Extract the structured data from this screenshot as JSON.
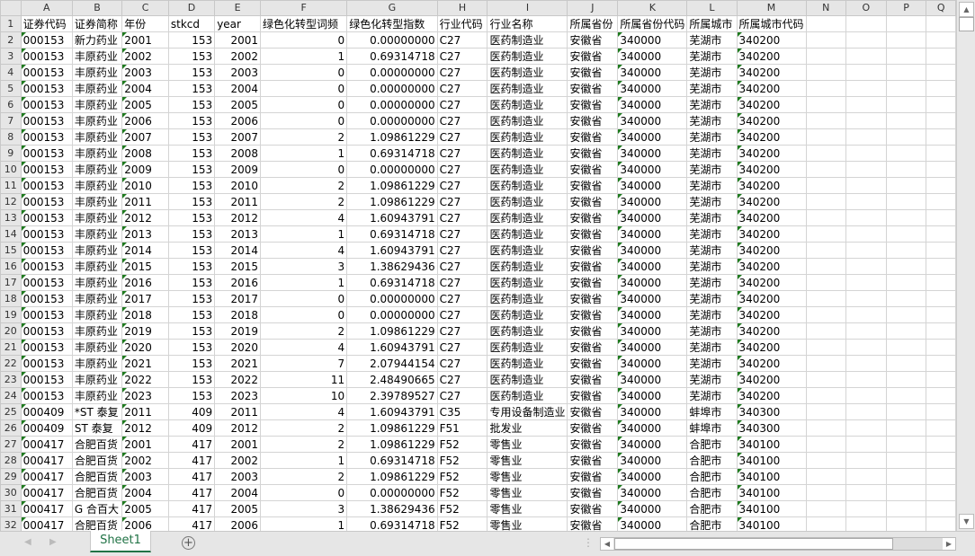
{
  "columns": [
    "A",
    "B",
    "C",
    "D",
    "E",
    "F",
    "G",
    "H",
    "I",
    "J",
    "K",
    "L",
    "M",
    "N",
    "O",
    "P",
    "Q"
  ],
  "headers": [
    "证券代码",
    "证券简称",
    "年份",
    "stkcd",
    "year",
    "绿色化转型词频",
    "绿色化转型指数",
    "行业代码",
    "行业名称",
    "所属省份",
    "所属省份代码",
    "所属城市",
    "所属城市代码"
  ],
  "rows": [
    [
      "000153",
      "新力药业",
      "2001",
      "153",
      "2001",
      "0",
      "0.00000000",
      "C27",
      "医药制造业",
      "安徽省",
      "340000",
      "芜湖市",
      "340200"
    ],
    [
      "000153",
      "丰原药业",
      "2002",
      "153",
      "2002",
      "1",
      "0.69314718",
      "C27",
      "医药制造业",
      "安徽省",
      "340000",
      "芜湖市",
      "340200"
    ],
    [
      "000153",
      "丰原药业",
      "2003",
      "153",
      "2003",
      "0",
      "0.00000000",
      "C27",
      "医药制造业",
      "安徽省",
      "340000",
      "芜湖市",
      "340200"
    ],
    [
      "000153",
      "丰原药业",
      "2004",
      "153",
      "2004",
      "0",
      "0.00000000",
      "C27",
      "医药制造业",
      "安徽省",
      "340000",
      "芜湖市",
      "340200"
    ],
    [
      "000153",
      "丰原药业",
      "2005",
      "153",
      "2005",
      "0",
      "0.00000000",
      "C27",
      "医药制造业",
      "安徽省",
      "340000",
      "芜湖市",
      "340200"
    ],
    [
      "000153",
      "丰原药业",
      "2006",
      "153",
      "2006",
      "0",
      "0.00000000",
      "C27",
      "医药制造业",
      "安徽省",
      "340000",
      "芜湖市",
      "340200"
    ],
    [
      "000153",
      "丰原药业",
      "2007",
      "153",
      "2007",
      "2",
      "1.09861229",
      "C27",
      "医药制造业",
      "安徽省",
      "340000",
      "芜湖市",
      "340200"
    ],
    [
      "000153",
      "丰原药业",
      "2008",
      "153",
      "2008",
      "1",
      "0.69314718",
      "C27",
      "医药制造业",
      "安徽省",
      "340000",
      "芜湖市",
      "340200"
    ],
    [
      "000153",
      "丰原药业",
      "2009",
      "153",
      "2009",
      "0",
      "0.00000000",
      "C27",
      "医药制造业",
      "安徽省",
      "340000",
      "芜湖市",
      "340200"
    ],
    [
      "000153",
      "丰原药业",
      "2010",
      "153",
      "2010",
      "2",
      "1.09861229",
      "C27",
      "医药制造业",
      "安徽省",
      "340000",
      "芜湖市",
      "340200"
    ],
    [
      "000153",
      "丰原药业",
      "2011",
      "153",
      "2011",
      "2",
      "1.09861229",
      "C27",
      "医药制造业",
      "安徽省",
      "340000",
      "芜湖市",
      "340200"
    ],
    [
      "000153",
      "丰原药业",
      "2012",
      "153",
      "2012",
      "4",
      "1.60943791",
      "C27",
      "医药制造业",
      "安徽省",
      "340000",
      "芜湖市",
      "340200"
    ],
    [
      "000153",
      "丰原药业",
      "2013",
      "153",
      "2013",
      "1",
      "0.69314718",
      "C27",
      "医药制造业",
      "安徽省",
      "340000",
      "芜湖市",
      "340200"
    ],
    [
      "000153",
      "丰原药业",
      "2014",
      "153",
      "2014",
      "4",
      "1.60943791",
      "C27",
      "医药制造业",
      "安徽省",
      "340000",
      "芜湖市",
      "340200"
    ],
    [
      "000153",
      "丰原药业",
      "2015",
      "153",
      "2015",
      "3",
      "1.38629436",
      "C27",
      "医药制造业",
      "安徽省",
      "340000",
      "芜湖市",
      "340200"
    ],
    [
      "000153",
      "丰原药业",
      "2016",
      "153",
      "2016",
      "1",
      "0.69314718",
      "C27",
      "医药制造业",
      "安徽省",
      "340000",
      "芜湖市",
      "340200"
    ],
    [
      "000153",
      "丰原药业",
      "2017",
      "153",
      "2017",
      "0",
      "0.00000000",
      "C27",
      "医药制造业",
      "安徽省",
      "340000",
      "芜湖市",
      "340200"
    ],
    [
      "000153",
      "丰原药业",
      "2018",
      "153",
      "2018",
      "0",
      "0.00000000",
      "C27",
      "医药制造业",
      "安徽省",
      "340000",
      "芜湖市",
      "340200"
    ],
    [
      "000153",
      "丰原药业",
      "2019",
      "153",
      "2019",
      "2",
      "1.09861229",
      "C27",
      "医药制造业",
      "安徽省",
      "340000",
      "芜湖市",
      "340200"
    ],
    [
      "000153",
      "丰原药业",
      "2020",
      "153",
      "2020",
      "4",
      "1.60943791",
      "C27",
      "医药制造业",
      "安徽省",
      "340000",
      "芜湖市",
      "340200"
    ],
    [
      "000153",
      "丰原药业",
      "2021",
      "153",
      "2021",
      "7",
      "2.07944154",
      "C27",
      "医药制造业",
      "安徽省",
      "340000",
      "芜湖市",
      "340200"
    ],
    [
      "000153",
      "丰原药业",
      "2022",
      "153",
      "2022",
      "11",
      "2.48490665",
      "C27",
      "医药制造业",
      "安徽省",
      "340000",
      "芜湖市",
      "340200"
    ],
    [
      "000153",
      "丰原药业",
      "2023",
      "153",
      "2023",
      "10",
      "2.39789527",
      "C27",
      "医药制造业",
      "安徽省",
      "340000",
      "芜湖市",
      "340200"
    ],
    [
      "000409",
      "*ST 泰复",
      "2011",
      "409",
      "2011",
      "4",
      "1.60943791",
      "C35",
      "专用设备制造业",
      "安徽省",
      "340000",
      "蚌埠市",
      "340300"
    ],
    [
      "000409",
      "ST 泰复",
      "2012",
      "409",
      "2012",
      "2",
      "1.09861229",
      "F51",
      "批发业",
      "安徽省",
      "340000",
      "蚌埠市",
      "340300"
    ],
    [
      "000417",
      "合肥百货",
      "2001",
      "417",
      "2001",
      "2",
      "1.09861229",
      "F52",
      "零售业",
      "安徽省",
      "340000",
      "合肥市",
      "340100"
    ],
    [
      "000417",
      "合肥百货",
      "2002",
      "417",
      "2002",
      "1",
      "0.69314718",
      "F52",
      "零售业",
      "安徽省",
      "340000",
      "合肥市",
      "340100"
    ],
    [
      "000417",
      "合肥百货",
      "2003",
      "417",
      "2003",
      "2",
      "1.09861229",
      "F52",
      "零售业",
      "安徽省",
      "340000",
      "合肥市",
      "340100"
    ],
    [
      "000417",
      "合肥百货",
      "2004",
      "417",
      "2004",
      "0",
      "0.00000000",
      "F52",
      "零售业",
      "安徽省",
      "340000",
      "合肥市",
      "340100"
    ],
    [
      "000417",
      "G 合百大",
      "2005",
      "417",
      "2005",
      "3",
      "1.38629436",
      "F52",
      "零售业",
      "安徽省",
      "340000",
      "合肥市",
      "340100"
    ],
    [
      "000417",
      "合肥百货",
      "2006",
      "417",
      "2006",
      "1",
      "0.69314718",
      "F52",
      "零售业",
      "安徽省",
      "340000",
      "合肥市",
      "340100"
    ]
  ],
  "sheet_tab": "Sheet1",
  "add_sheet": "+"
}
